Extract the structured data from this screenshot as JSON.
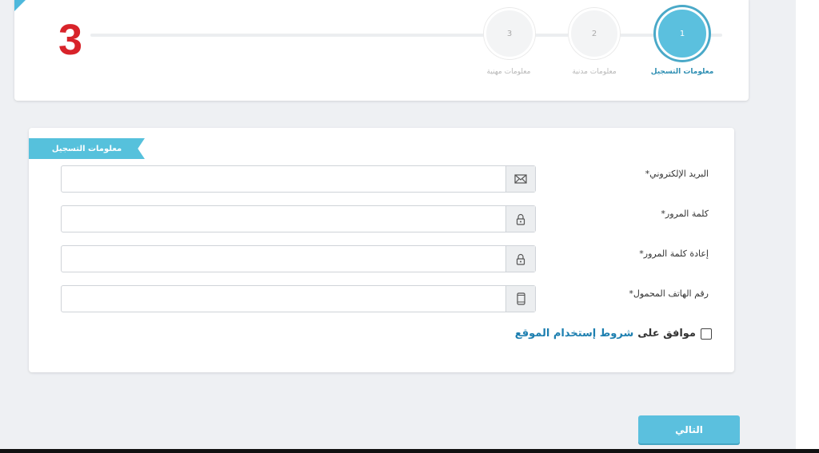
{
  "annotation_number": "3",
  "wizard": {
    "steps": [
      {
        "number": "1",
        "label": "معلومات التسجيل",
        "active": true
      },
      {
        "number": "2",
        "label": "معلومات مدنية",
        "active": false
      },
      {
        "number": "3",
        "label": "معلومات مهنية",
        "active": false
      }
    ]
  },
  "form": {
    "section_title": "معلومات التسجيل",
    "fields": [
      {
        "label": "البريد الإلكتروني",
        "icon": "envelope-icon",
        "value": "",
        "placeholder": ""
      },
      {
        "label": "كلمة المرور",
        "icon": "lock-icon",
        "value": "",
        "placeholder": ""
      },
      {
        "label": "إعادة كلمة المرور",
        "icon": "lock-icon",
        "value": "",
        "placeholder": ""
      },
      {
        "label": "رقم الهاتف المحمول",
        "icon": "mobile-phone-icon",
        "value": "",
        "placeholder": ""
      }
    ],
    "required_marker": "*",
    "terms": {
      "prefix": "موافق على",
      "link": "شروط إستخدام الموقع"
    }
  },
  "next_button_label": "التالي",
  "colors": {
    "accent": "#5bc0de",
    "link": "#1d7fb0",
    "annotation": "#d8232a"
  }
}
